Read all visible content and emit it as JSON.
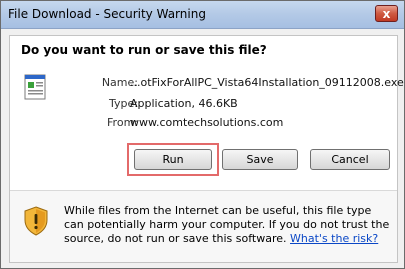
{
  "window": {
    "title": "File Download - Security Warning",
    "close_label": "x"
  },
  "dialog": {
    "question": "Do you want to run or save this file?"
  },
  "file": {
    "name_label": "Name:",
    "name_value": "...otFixForAllPC_Vista64Installation_09112008.exe",
    "type_label": "Type:",
    "type_value": "Application, 46.6KB",
    "from_label": "From:",
    "from_value": "www.comtechsolutions.com",
    "icon": "application-file-icon"
  },
  "buttons": {
    "run": "Run",
    "save": "Save",
    "cancel": "Cancel"
  },
  "warning": {
    "text": "While files from the Internet can be useful, this file type can potentially harm your computer. If you do not trust the source, do not run or save this software.",
    "link": "What's the risk?",
    "icon": "shield-warning-icon"
  },
  "colors": {
    "highlight": "#e36a6a",
    "link": "#0a47c6"
  }
}
